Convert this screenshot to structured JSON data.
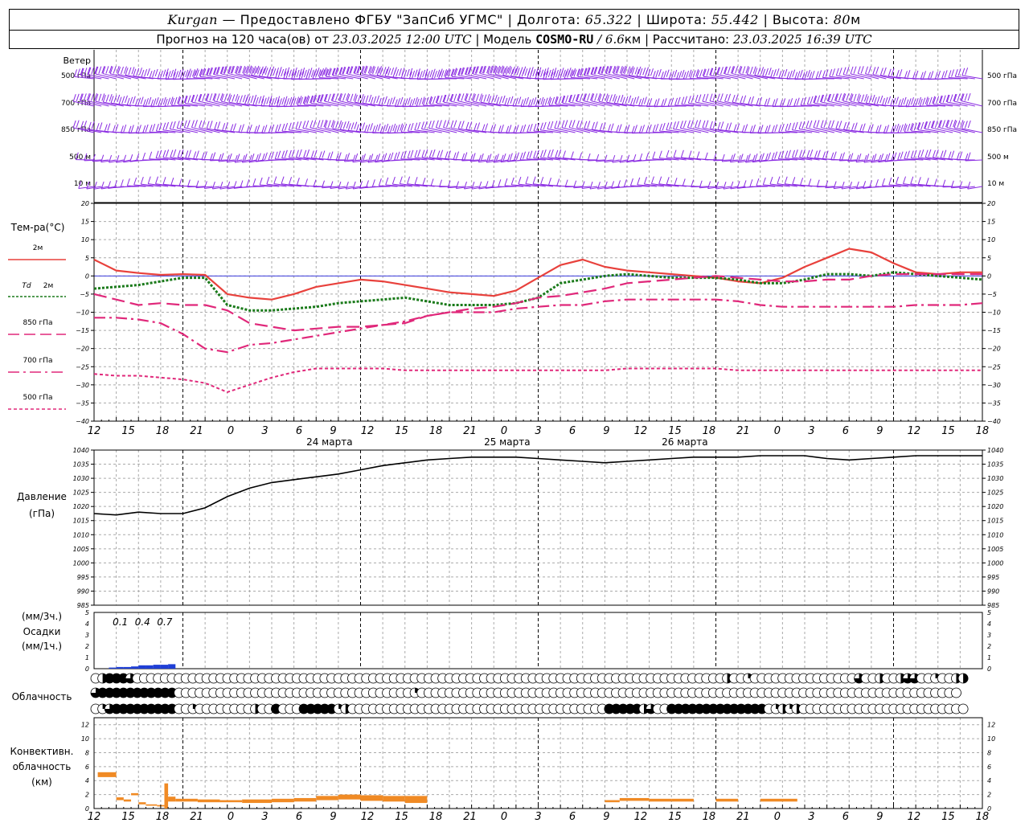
{
  "header": {
    "line1": {
      "station": "Kurgan",
      "provider": " — Предоставлено ФГБУ \"ЗапСиб УГМС\" | Долгота: ",
      "lon": "65.322",
      "lat_label": " | Широта: ",
      "lat": "55.442",
      "alt_label": " | Высота: ",
      "alt": "80",
      "alt_unit": "м"
    },
    "line2": {
      "prefix": "Прогноз на 120 часа(ов) от ",
      "init": "23.03.2025 12:00 UTC",
      "model_label": " | Модель ",
      "model": "COSMO-RU",
      "res": " / 6.6",
      "res_unit": "км",
      "calc_label": " | Рассчитано: ",
      "calc": "23.03.2025 16:39 UTC"
    }
  },
  "colors": {
    "wind": "#8a2be2",
    "t2m": "#e8413c",
    "td2m": "#1a7a1a",
    "t850": "#e0287a",
    "t700": "#e0287a",
    "t500": "#e0287a",
    "pressure": "#000000",
    "precip": "#1f3fd6",
    "convective": "#f08a24",
    "zero_line": "#3a3adb"
  },
  "chart_data": [
    {
      "type": "wind_barbs",
      "row_label": "Ветер",
      "levels": [
        "500 гПа",
        "700 гПа",
        "850 гПа",
        "500 м",
        "10 м"
      ],
      "note": "wind barbs every 1 h, westerly to north-westerly flow"
    },
    {
      "type": "line",
      "ylabel": "Тем-ра(°С)",
      "ylim": [
        -40,
        20
      ],
      "yticks": [
        20,
        15,
        10,
        5,
        0,
        -5,
        -10,
        -15,
        -20,
        -25,
        -30,
        -35,
        -40
      ],
      "x_hours": [
        0,
        3,
        6,
        9,
        12,
        15,
        18,
        21,
        24,
        27,
        30,
        33,
        36,
        39,
        42,
        45,
        48,
        51,
        54,
        57,
        60,
        63,
        66,
        69,
        72,
        75,
        78,
        81,
        84,
        87,
        90,
        93,
        96,
        99,
        102,
        105,
        108,
        111,
        114,
        117,
        120
      ],
      "series": [
        {
          "name": "2м",
          "style": "solid",
          "values": [
            4.5,
            1.5,
            0.8,
            0.3,
            0.5,
            0.3,
            -5,
            -6,
            -6.5,
            -5,
            -3,
            -2,
            -1,
            -1.5,
            -2.5,
            -3.5,
            -4.5,
            -5,
            -5.5,
            -4,
            -0.5,
            3,
            4.5,
            2.5,
            1.5,
            1,
            0.5,
            0,
            -0.5,
            -1.5,
            -2,
            -0.5,
            2.5,
            5,
            7.5,
            6.5,
            3.5,
            1,
            0.5,
            1,
            1
          ]
        },
        {
          "name": "Td 2м",
          "style": "dotted",
          "values": [
            -3.5,
            -3,
            -2.5,
            -1.5,
            -0.5,
            -0.5,
            -8,
            -9.5,
            -9.5,
            -9,
            -8.5,
            -7.5,
            -7,
            -6.5,
            -6,
            -7,
            -8,
            -8,
            -8,
            -7.5,
            -6,
            -2,
            -1,
            0,
            0.5,
            0,
            -0.5,
            -0.5,
            -0.5,
            -1,
            -2,
            -2,
            -1,
            0.5,
            0.5,
            0,
            1,
            0.5,
            0,
            -0.5,
            -1
          ]
        },
        {
          "name": "850 гПа",
          "style": "dash",
          "values": [
            -5,
            -6.5,
            -8,
            -7.5,
            -8,
            -8,
            -9.5,
            -13,
            -14,
            -15,
            -14.5,
            -14,
            -14,
            -13.5,
            -13,
            -11,
            -10,
            -9,
            -8.5,
            -7.5,
            -6,
            -5.5,
            -4.5,
            -3.5,
            -2,
            -1.5,
            -1,
            -0.5,
            0,
            -0.5,
            -1,
            -1.5,
            -1.5,
            -1,
            -1,
            0,
            0.5,
            0.5,
            0.5,
            0.5,
            0.5
          ]
        },
        {
          "name": "700 гПа",
          "style": "dashdot",
          "values": [
            -11.5,
            -11.5,
            -12,
            -13,
            -16,
            -20,
            -21,
            -19,
            -18.5,
            -17.5,
            -16.5,
            -15.5,
            -14.5,
            -13.5,
            -12.5,
            -11,
            -10,
            -10,
            -10,
            -9,
            -8.5,
            -8,
            -8,
            -7,
            -6.5,
            -6.5,
            -6.5,
            -6.5,
            -6.5,
            -7,
            -8,
            -8.5,
            -8.5,
            -8.5,
            -8.5,
            -8.5,
            -8.5,
            -8,
            -8,
            -8,
            -7.5
          ]
        },
        {
          "name": "500 гПа",
          "style": "short-dash",
          "values": [
            -27,
            -27.5,
            -27.5,
            -28,
            -28.5,
            -29.5,
            -32,
            -30,
            -28,
            -26.5,
            -25.5,
            -25.5,
            -25.5,
            -25.5,
            -26,
            -26,
            -26,
            -26,
            -26,
            -26,
            -26,
            -26,
            -26,
            -26,
            -25.5,
            -25.5,
            -25.5,
            -25.5,
            -25.5,
            -26,
            -26,
            -26,
            -26,
            -26,
            -26,
            -26,
            -26,
            -26,
            -26,
            -26,
            -26
          ]
        }
      ]
    },
    {
      "type": "line",
      "ylabel": "Давление",
      "yunit": "(гПа)",
      "ylim": [
        985,
        1040
      ],
      "yticks": [
        1040,
        1035,
        1030,
        1025,
        1020,
        1015,
        1010,
        1005,
        1000,
        995,
        990,
        985
      ],
      "x_hours": [
        0,
        3,
        6,
        9,
        12,
        15,
        18,
        21,
        24,
        27,
        30,
        33,
        36,
        39,
        42,
        45,
        48,
        51,
        54,
        57,
        60,
        63,
        66,
        69,
        72,
        75,
        78,
        81,
        84,
        87,
        90,
        93,
        96,
        99,
        102,
        105,
        108,
        111,
        114,
        117,
        120
      ],
      "series": [
        {
          "name": "Давление",
          "values": [
            1017.5,
            1017,
            1018,
            1017.5,
            1017.5,
            1019.5,
            1023.5,
            1026.5,
            1028.5,
            1029.5,
            1030.5,
            1031.5,
            1033,
            1034.5,
            1035.5,
            1036.5,
            1037,
            1037.5,
            1037.5,
            1037.5,
            1037,
            1036.5,
            1036,
            1035.5,
            1036,
            1036.5,
            1037,
            1037.5,
            1037.5,
            1037.5,
            1038,
            1038,
            1038,
            1037,
            1036.5,
            1037,
            1037.5,
            1038,
            1038,
            1038,
            1038
          ]
        }
      ]
    },
    {
      "type": "bar",
      "ylabel_top": "(мм/3ч.)",
      "ylabel": "Осадки",
      "ylabel_bottom": "(мм/1ч.)",
      "ylim": [
        0,
        5
      ],
      "yticks": [
        5,
        4,
        3,
        2,
        1,
        0
      ],
      "annotations": [
        {
          "hour": 3,
          "text": "0.1"
        },
        {
          "hour": 6,
          "text": "0.4"
        },
        {
          "hour": 9,
          "text": "0.7"
        }
      ],
      "hourly_values": [
        {
          "hour": 2,
          "value": 0.1
        },
        {
          "hour": 3,
          "value": 0.15
        },
        {
          "hour": 4,
          "value": 0.15
        },
        {
          "hour": 5,
          "value": 0.2
        },
        {
          "hour": 6,
          "value": 0.3
        },
        {
          "hour": 7,
          "value": 0.3
        },
        {
          "hour": 8,
          "value": 0.35
        },
        {
          "hour": 9,
          "value": 0.35
        },
        {
          "hour": 10,
          "value": 0.4
        }
      ]
    },
    {
      "type": "cloud_cover",
      "ylabel": "Облачность",
      "note": "three rows of circle symbols (total, low, middle cloud), fill fraction 0..1 per hour",
      "rows": [
        {
          "level": "total",
          "values": [
            0,
            0.5,
            1,
            1,
            1,
            0.75,
            0,
            0,
            0,
            0,
            0,
            0,
            0,
            0,
            0,
            0,
            0,
            0,
            0,
            0,
            0,
            0,
            0,
            0,
            0,
            0,
            0,
            0,
            0,
            0,
            0,
            0,
            0,
            0,
            0,
            0,
            0,
            0,
            0,
            0,
            0,
            0,
            0,
            0,
            0,
            0,
            0,
            0,
            0,
            0,
            0,
            0,
            0,
            0,
            0,
            0,
            0,
            0,
            0,
            0,
            0,
            0,
            0,
            0,
            0,
            0,
            0,
            0,
            0,
            0,
            0,
            0,
            0,
            0,
            0,
            0,
            0,
            0,
            0,
            0,
            0,
            0,
            0,
            0,
            0,
            0,
            0,
            0,
            0,
            0,
            0,
            0.5,
            0,
            0,
            0.25,
            0,
            0,
            0,
            0,
            0,
            0,
            0,
            0,
            0,
            0,
            0,
            0,
            0,
            0,
            0,
            0.75,
            0,
            0,
            0.5,
            0,
            0,
            0.5,
            0.75,
            0.75,
            0,
            0,
            0.25,
            0,
            0,
            0.5,
            0.5
          ]
        },
        {
          "level": "low",
          "values": [
            0.75,
            1,
            1,
            1,
            1,
            1,
            1,
            1,
            1,
            1,
            1,
            1,
            0,
            0,
            0,
            0,
            0,
            0,
            0,
            0,
            0,
            0,
            0,
            0,
            0,
            0,
            0,
            0,
            0,
            0,
            0,
            0,
            0,
            0,
            0,
            0,
            0,
            0,
            0,
            0,
            0,
            0,
            0,
            0,
            0,
            0,
            0.25,
            0,
            0,
            0,
            0,
            0,
            0,
            0,
            0,
            0,
            0,
            0,
            0,
            0,
            0,
            0,
            0,
            0,
            0,
            0,
            0,
            0,
            0,
            0,
            0,
            0,
            0,
            0,
            0,
            0,
            0,
            0,
            0,
            0,
            0,
            0,
            0,
            0,
            0,
            0,
            0,
            0,
            0,
            0,
            0,
            0,
            0,
            0,
            0,
            0,
            0,
            0,
            0,
            0,
            0,
            0,
            0,
            0,
            0,
            0,
            0,
            0,
            0,
            0,
            0,
            0,
            0,
            0,
            0,
            0,
            0,
            0,
            0,
            0,
            0,
            0,
            0,
            0,
            0
          ]
        },
        {
          "level": "middle",
          "values": [
            0,
            0.25,
            0.75,
            1,
            1,
            1,
            1,
            1,
            1,
            1,
            1,
            1,
            0,
            0,
            0.25,
            0,
            0,
            0,
            0,
            0,
            0,
            0,
            0,
            0.5,
            0,
            0,
            1,
            0,
            0,
            0,
            1,
            1,
            1,
            1,
            1,
            0.25,
            0.5,
            0,
            0,
            0,
            0,
            0,
            0,
            0,
            0,
            0,
            0,
            0,
            0,
            0,
            0,
            0,
            0,
            0,
            0,
            0,
            0,
            0,
            0,
            0,
            0,
            0,
            0,
            0,
            0,
            0,
            0,
            0,
            0,
            0,
            0,
            0,
            0,
            0,
            1,
            1,
            1,
            1,
            1,
            0.5,
            0.75,
            0,
            0,
            1,
            1,
            1,
            1,
            1,
            1,
            1,
            1,
            1,
            1,
            1,
            1,
            1,
            1,
            0,
            0.25,
            0.5,
            0.25,
            0.5,
            0,
            0,
            0,
            0,
            0,
            0,
            0,
            0,
            0,
            0,
            0,
            0,
            0,
            0,
            0,
            0,
            0,
            0,
            0,
            0,
            0,
            0,
            0,
            0
          ]
        }
      ]
    },
    {
      "type": "bar",
      "ylabel": "Конвективн.",
      "ylabel2": "облачность",
      "yunit": "(км)",
      "ylim": [
        0,
        13
      ],
      "yticks": [
        12,
        10,
        8,
        6,
        4,
        2,
        0
      ],
      "bars": [
        {
          "from": 0.5,
          "to": 3,
          "bottom": 4.5,
          "top": 5.2
        },
        {
          "from": 3,
          "to": 4,
          "bottom": 1.2,
          "top": 1.6
        },
        {
          "from": 4,
          "to": 5,
          "bottom": 1.0,
          "top": 1.3
        },
        {
          "from": 5,
          "to": 6,
          "bottom": 1.9,
          "top": 2.2
        },
        {
          "from": 6,
          "to": 7,
          "bottom": 0.6,
          "top": 0.9
        },
        {
          "from": 7,
          "to": 8.5,
          "bottom": 0.4,
          "top": 0.6
        },
        {
          "from": 8.5,
          "to": 9.5,
          "bottom": 0.3,
          "top": 0.5
        },
        {
          "from": 9.5,
          "to": 10,
          "bottom": 0,
          "top": 3.6
        },
        {
          "from": 10,
          "to": 11,
          "bottom": 1.0,
          "top": 1.7
        },
        {
          "from": 11,
          "to": 14,
          "bottom": 1.0,
          "top": 1.4
        },
        {
          "from": 14,
          "to": 17,
          "bottom": 0.9,
          "top": 1.3
        },
        {
          "from": 17,
          "to": 20,
          "bottom": 0.9,
          "top": 1.2
        },
        {
          "from": 20,
          "to": 24,
          "bottom": 0.8,
          "top": 1.3
        },
        {
          "from": 24,
          "to": 27,
          "bottom": 0.9,
          "top": 1.4
        },
        {
          "from": 27,
          "to": 30,
          "bottom": 1.0,
          "top": 1.5
        },
        {
          "from": 30,
          "to": 33,
          "bottom": 1.2,
          "top": 1.8
        },
        {
          "from": 33,
          "to": 36,
          "bottom": 1.3,
          "top": 2.0
        },
        {
          "from": 36,
          "to": 39,
          "bottom": 1.1,
          "top": 1.9
        },
        {
          "from": 39,
          "to": 42,
          "bottom": 1.0,
          "top": 1.8
        },
        {
          "from": 42,
          "to": 45,
          "bottom": 0.8,
          "top": 1.8
        },
        {
          "from": 69,
          "to": 71,
          "bottom": 0.9,
          "top": 1.2
        },
        {
          "from": 71,
          "to": 75,
          "bottom": 1.1,
          "top": 1.5
        },
        {
          "from": 75,
          "to": 78,
          "bottom": 1.0,
          "top": 1.4
        },
        {
          "from": 78,
          "to": 81,
          "bottom": 1.0,
          "top": 1.4
        },
        {
          "from": 84,
          "to": 87,
          "bottom": 1.0,
          "top": 1.4
        },
        {
          "from": 90,
          "to": 95,
          "bottom": 1.0,
          "top": 1.4
        }
      ]
    }
  ],
  "x_axis": {
    "hour_labels": [
      "12",
      "15",
      "18",
      "21",
      "0",
      "3",
      "6",
      "9",
      "12",
      "15",
      "18",
      "21",
      "0",
      "3",
      "6",
      "9",
      "12",
      "15",
      "18",
      "21",
      "0",
      "3",
      "6",
      "9",
      "12",
      "15",
      "18"
    ],
    "day_labels": [
      {
        "hour": 24,
        "text": "24 марта"
      },
      {
        "hour": 48,
        "text": "25 марта"
      },
      {
        "hour": 72,
        "text": "26 марта"
      }
    ]
  },
  "legend": {
    "t2m": "2м",
    "td_prefix": "Td",
    "td_suffix": "2м",
    "t850": "850 гПа",
    "t700": "700 гПа",
    "t500": "500 гПа"
  }
}
